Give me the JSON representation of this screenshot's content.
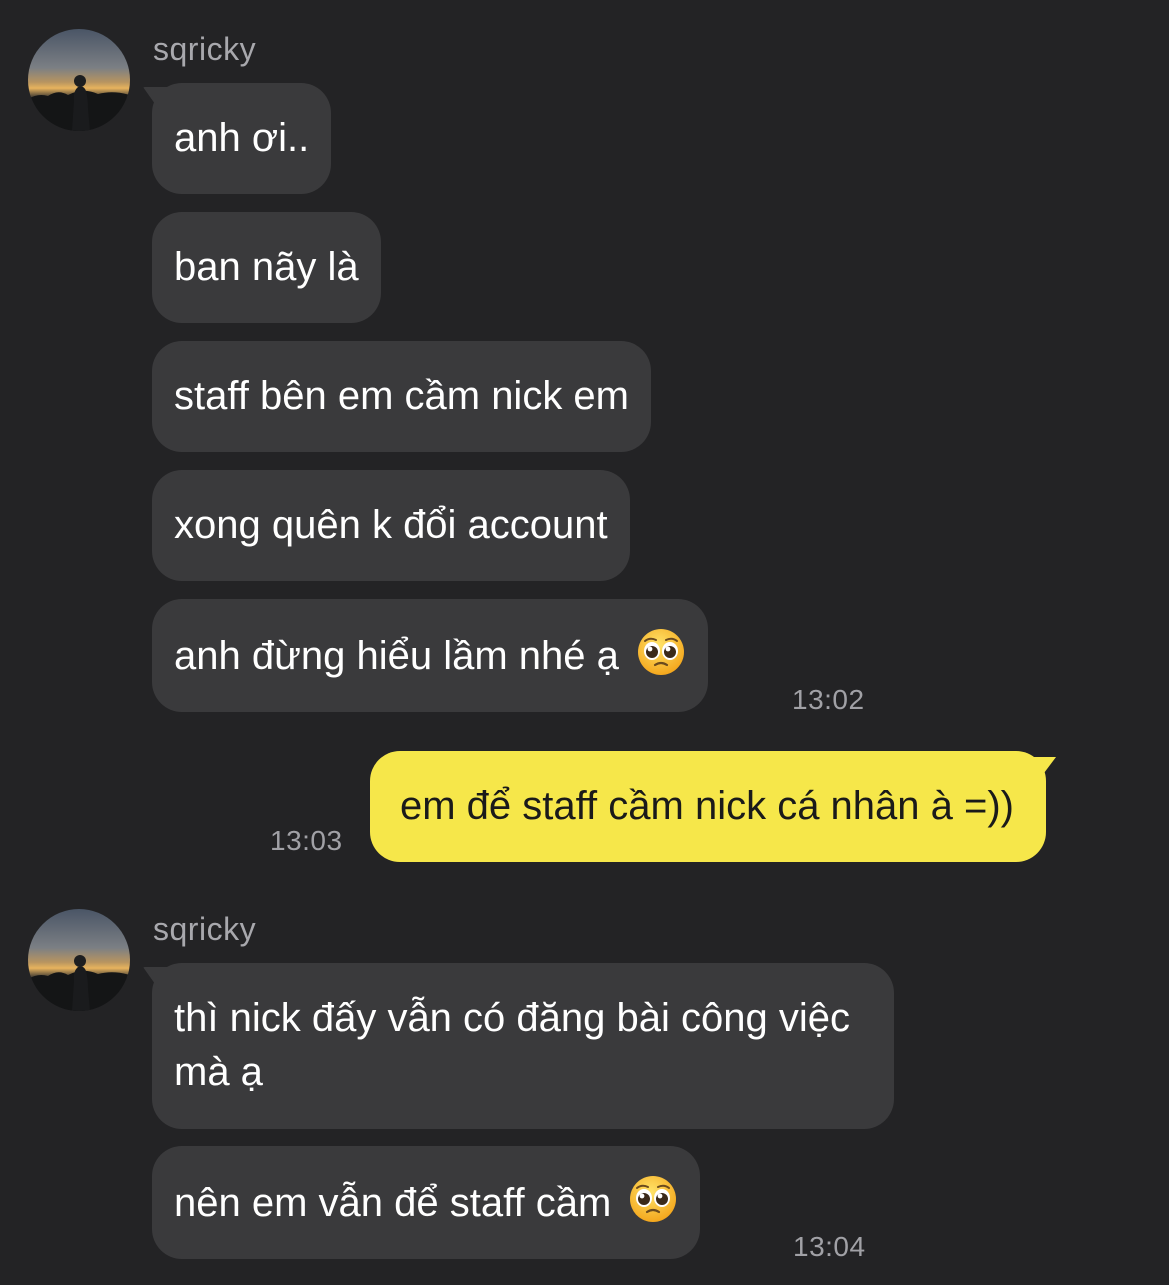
{
  "groups": [
    {
      "sender": "sqricky",
      "messages": [
        {
          "text": "anh ơi.."
        },
        {
          "text": "ban nãy là"
        },
        {
          "text": "staff bên em cầm nick em"
        },
        {
          "text": "xong quên k đổi account"
        },
        {
          "text": "anh đừng hiểu lầm nhé ạ",
          "emoji": "pleading-face"
        }
      ],
      "time": "13:02"
    },
    {
      "sender": "me",
      "messages": [
        {
          "text": "em để staff cầm nick cá nhân à =))"
        }
      ],
      "time": "13:03"
    },
    {
      "sender": "sqricky",
      "messages": [
        {
          "text": "thì nick đấy vẫn có đăng bài công việc mà ạ"
        },
        {
          "text": "nên em vẫn để staff cầm",
          "emoji": "pleading-face"
        }
      ],
      "time": "13:04"
    }
  ],
  "colors": {
    "background": "#232325",
    "incoming_bubble": "#3a3a3c",
    "outgoing_bubble": "#f6e74a",
    "text_light": "#ffffff",
    "text_dark": "#1a1a1a",
    "meta_text": "#a1a1a6"
  }
}
